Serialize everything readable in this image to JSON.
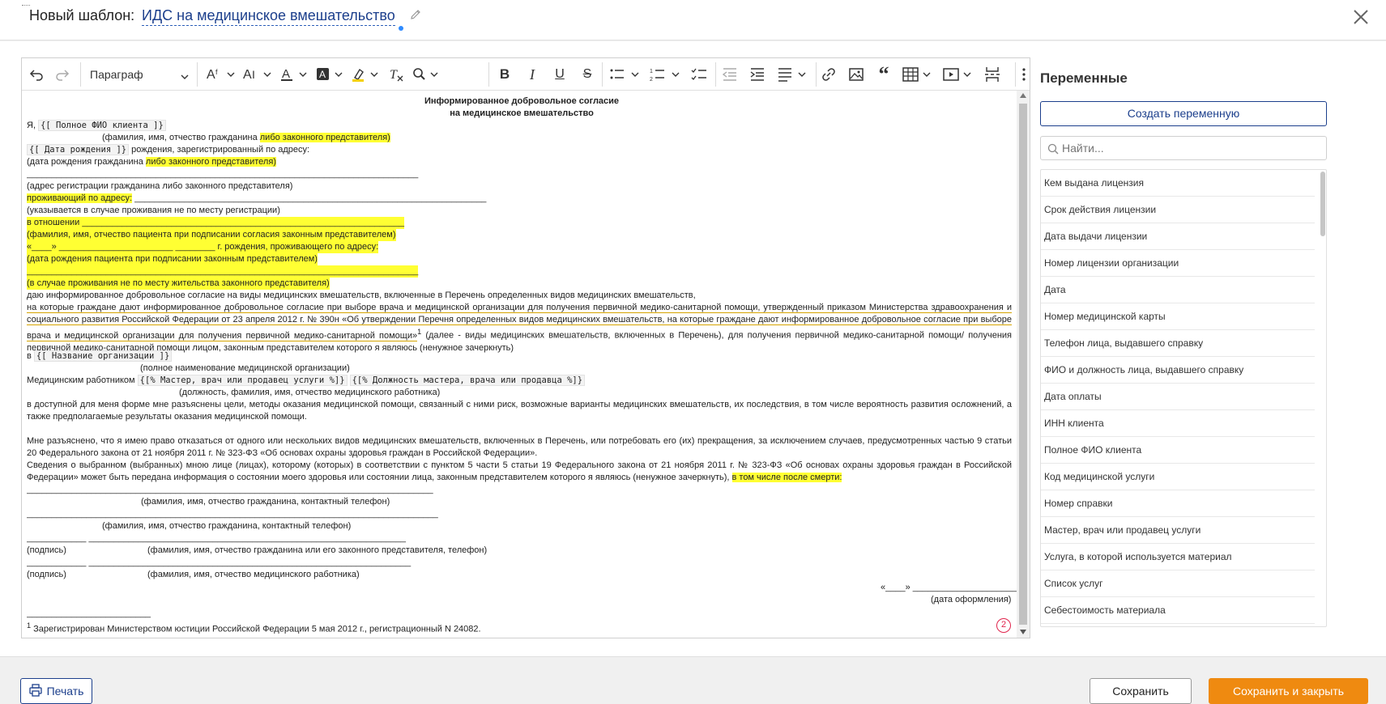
{
  "header": {
    "label": "Новый шаблон:",
    "title": "ИДС на медицинское вмешательство"
  },
  "toolbar": {
    "paragraph_select": "Параграф"
  },
  "document": {
    "title1": "Информированное добровольное согласие",
    "title2": "на медицинское вмешательство",
    "l1_pre": "Я, ",
    "var_fio": "{[ Полное ФИО клиента ]}",
    "l2_pre": "(фамилия, имя, отчество гражданина ",
    "hl_legal_rep": "либо законного представителя)",
    "var_birth": "{[ Дата рождения ]}",
    "l3_post": " рождения, зарегистрированный по адресу:",
    "l4_pre": "(дата рождения гражданина ",
    "hl_legal_rep2": "либо законного представителя)",
    "l5_line": "_______________________________________________________________________________",
    "l6": "(адрес регистрации гражданина либо законного представителя)",
    "l7_hl": "проживающий по адресу:",
    "l7_line": " _______________________________________________________________________",
    "l8": "(указывается в случае проживания не по месту регистрации)",
    "l9": "в отношении _________________________________________________________________",
    "l10": "(фамилия, имя, отчество пациента при подписании согласия законным представителем)",
    "l11": "«____» _______________________ ________ г. рождения, проживающего по адресу:",
    "l12": "(дата рождения пациента при подписании законным представителем)",
    "l13": "_______________________________________________________________________________",
    "l14": "(в случае проживания не по месту жительства законного представителя)",
    "l15": "даю информированное добровольное согласие на виды медицинских вмешательств, включенные в Перечень определенных видов медицинских вмешательств,",
    "p1": "на которые граждане дают информированное добровольное согласие при выборе врача и медицинской организации для получения первичной медико-санитарной помощи, утвержденный приказом Министерства здравоохранения и социального развития Российской Федерации от 23 апреля 2012 г. № 390н «Об утверждении Перечня определенных видов медицинских вмешательств, на которые граждане дают информированное добровольное согласие при выборе врача и медицинской организации для получения первичной медико-санитарной помощи»",
    "p1_sup": "1",
    "p1_end": " (далее - виды медицинских вмешательств, включенных в Перечень), для получения первичной медико-санитарной помощи/ получения первичной медико-санитарной помощи лицом, законным представителем которого я являюсь (ненужное зачеркнуть)",
    "l_org_pre": "в ",
    "var_org": "{[ Название организации ]}",
    "l_org_caption": "(полное наименование медицинской организации)",
    "l_med_pre": "Медицинским работником ",
    "var_master": "{[% Мастер, врач или продавец услуги %]}",
    "var_position": "{[% Должность мастера, врача или продавца %]}",
    "l_med_caption": "(должность, фамилия, имя, отчество медицинского работника)",
    "p2": "в доступной для меня форме мне разъяснены цели, методы оказания медицинской помощи, связанный с ними риск, возможные варианты медицинских вмешательств, их последствия, в том числе вероятность развития осложнений, а также предполагаемые результаты оказания медицинской помощи.",
    "p3": "Мне разъяснено, что я имею право отказаться от одного или нескольких видов медицинских вмешательств, включенных в Перечень, или потребовать его (их) прекращения, за исключением случаев, предусмотренных частью 9 статьи 20 Федерального закона от 21 ноября 2011 г. № 323-ФЗ «Об основах охраны здоровья граждан в Российской Федерации».",
    "p4": "Сведения о выбранном (выбранных) мною лице (лицах), которому (которых) в соответствии с пунктом 5 части 5 статьи 19 Федерального закона от 21 ноября 2011 г. № 323-ФЗ «Об основах охраны здоровья граждан в Российской Федерации» может быть передана информация о состоянии моего здоровья или состоянии лица, законным представителем которого я являюсь (ненужное зачеркнуть), ",
    "p4_hl": "в том числе после смерти:",
    "s_line1": "__________________________________________________________________________________",
    "s_cap1": "(фамилия, имя, отчество гражданина, контактный телефон)",
    "s_line2": "___________________________________________________________________________________",
    "s_cap2": "(фамилия, имя, отчество гражданина, контактный телефон)",
    "s_line3": "____________   ________________________________________________________________",
    "s_sig1": "(подпись)",
    "s_cap3": "(фамилия, имя, отчество гражданина или его законного представителя, телефон)",
    "s_line4": "____________   _________________________________________________________________",
    "s_sig2": "(подпись)",
    "s_cap4": "(фамилия, имя, отчество медицинского работника)",
    "date_line": "«____» _____________________ г.",
    "date_caption": "(дата оформления)",
    "fn_line": "_________________________",
    "fn_sup": "1",
    "fn_text": " Зарегистрирован Министерством юстиции Российской Федерации 5 мая 2012 г., регистрационный N 24082."
  },
  "error_count": "2",
  "sidebar": {
    "title": "Переменные",
    "create_button": "Создать переменную",
    "search_placeholder": "Найти...",
    "items": [
      "Кем выдана лицензия",
      "Срок действия лицензии",
      "Дата выдачи лицензии",
      "Номер лицензии организации",
      "Дата",
      "Номер медицинской карты",
      "Телефон лица, выдавшего справку",
      "ФИО и должность лица, выдавшего справку",
      "Дата оплаты",
      "ИНН клиента",
      "Полное ФИО клиента",
      "Код медицинской услуги",
      "Номер справки",
      "Мастер, врач или продавец услуги",
      "Услуга, в которой используется материал",
      "Список услуг",
      "Себестоимость материала"
    ]
  },
  "footer": {
    "print_label": "Печать",
    "save_label": "Сохранить",
    "save_close_label": "Сохранить и закрыть"
  },
  "colors": {
    "accent": "#1c3f8c",
    "highlight": "#ffff33",
    "primary_button": "#ef8a10",
    "error": "#e0244c"
  }
}
